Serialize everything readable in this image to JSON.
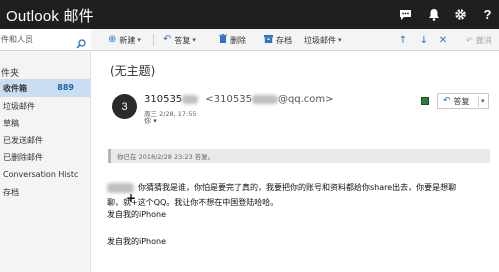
{
  "app": {
    "title": "Outlook 邮件"
  },
  "topbar": {
    "icons": [
      "chat-icon",
      "bell-icon",
      "gear-icon",
      "help-icon"
    ]
  },
  "search": {
    "placeholder": "件和人员"
  },
  "toolbar": {
    "new_label": "新建",
    "reply_label": "答复",
    "delete_label": "删除",
    "archive_label": "存档",
    "junk_label": "垃圾邮件",
    "undo_label": "撤消"
  },
  "sidebar": {
    "heading": "件夹",
    "items": [
      {
        "label": "收件箱",
        "count": "889",
        "active": true
      },
      {
        "label": "垃圾邮件"
      },
      {
        "label": "草稿"
      },
      {
        "label": "已发送邮件"
      },
      {
        "label": "已删除邮件"
      },
      {
        "label": "Conversation Histc"
      },
      {
        "label": "存档"
      }
    ]
  },
  "message": {
    "subject": "(无主题)",
    "avatar_initial": "3",
    "sender_name_prefix": "310535",
    "sender_email_prefix": "<310535",
    "sender_email_suffix": "@qq.com>",
    "date": "周三 2/28, 17:55",
    "to": "你 ▾",
    "reply_button_label": "答复",
    "reply_notice": "你已在 2018/2/28 23:23 答复。",
    "body_line1": "你猜猜我是谁，你怕是要完了真的，我要把你的账号和资料都给你share出去，你要是想聊",
    "body_line2": "聊，就+这个QQ。我让你不想在中国登陆哈哈。",
    "body_line3": "发自我的iPhone",
    "body_line4": "发自我的iPhone"
  },
  "colors": {
    "topbar": "#1f1f1f",
    "accent": "#2e73c4",
    "selected": "#c8def3"
  }
}
